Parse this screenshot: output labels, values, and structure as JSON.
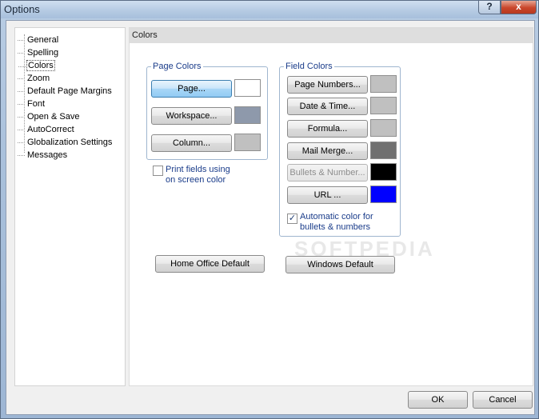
{
  "window": {
    "title": "Options",
    "help_label": "?",
    "close_label": "x"
  },
  "tree": {
    "items": [
      {
        "label": "General"
      },
      {
        "label": "Spelling"
      },
      {
        "label": "Colors"
      },
      {
        "label": "Zoom"
      },
      {
        "label": "Default Page Margins"
      },
      {
        "label": "Font"
      },
      {
        "label": "Open & Save"
      },
      {
        "label": "AutoCorrect"
      },
      {
        "label": "Globalization Settings"
      },
      {
        "label": "Messages"
      }
    ],
    "selected": "Colors"
  },
  "panel": {
    "header": "Colors",
    "page_colors": {
      "legend": "Page Colors",
      "page_label": "Page...",
      "page_color": "#ffffff",
      "workspace_label": "Workspace...",
      "workspace_color": "#8e99ab",
      "column_label": "Column...",
      "column_color": "#c0c0c0"
    },
    "print_fields": {
      "label": "Print fields using on screen color",
      "line1": "Print fields using",
      "line2": "on screen color",
      "checked": false
    },
    "field_colors": {
      "legend": "Field Colors",
      "page_numbers_label": "Page Numbers...",
      "page_numbers_color": "#c0c0c0",
      "date_time_label": "Date & Time...",
      "date_time_color": "#c0c0c0",
      "formula_label": "Formula...",
      "formula_color": "#c0c0c0",
      "mail_merge_label": "Mail Merge...",
      "mail_merge_color": "#707070",
      "bullets_label": "Bullets & Number...",
      "bullets_color": "#000000",
      "url_label": "URL ...",
      "url_color": "#0000ff",
      "auto_color_line1": "Automatic color for",
      "auto_color_line2": "bullets & numbers",
      "auto_color_checked": true,
      "check_mark": "✓"
    },
    "home_office_default_label": "Home Office Default",
    "windows_default_label": "Windows Default"
  },
  "footer": {
    "ok_label": "OK",
    "cancel_label": "Cancel"
  },
  "watermark": "SOFTPEDIA"
}
